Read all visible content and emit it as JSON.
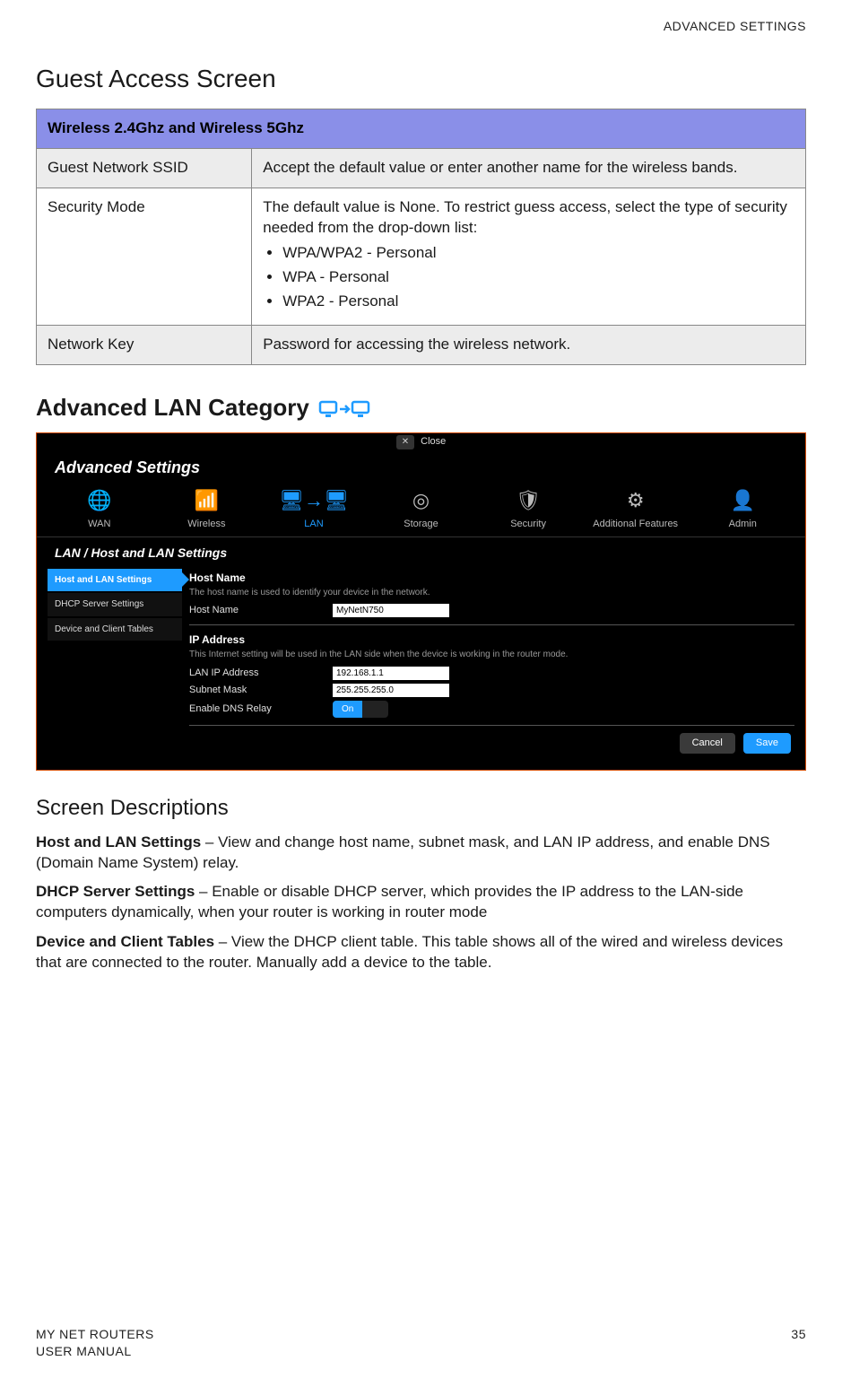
{
  "header": {
    "section": "ADVANCED SETTINGS"
  },
  "guest": {
    "heading": "Guest Access Screen",
    "table_header": "Wireless 2.4Ghz and Wireless 5Ghz",
    "rows": [
      {
        "label": "Guest Network SSID",
        "desc": "Accept the default value or enter another name for the wireless bands."
      },
      {
        "label": "Security Mode",
        "desc": "The default value is None. To restrict guess access, select the type of security needed from the drop-down list:",
        "bullets": [
          "WPA/WPA2 - Personal",
          "WPA - Personal",
          "WPA2 - Personal"
        ]
      },
      {
        "label": "Network Key",
        "desc": "Password for accessing the wireless network."
      }
    ]
  },
  "lan": {
    "heading": "Advanced LAN Category"
  },
  "screenshot": {
    "close_label": "Close",
    "title": "Advanced Settings",
    "tabs": [
      "WAN",
      "Wireless",
      "LAN",
      "Storage",
      "Security",
      "Additional Features",
      "Admin"
    ],
    "subhead": "LAN / Host and LAN Settings",
    "side": [
      "Host and LAN Settings",
      "DHCP Server Settings",
      "Device and Client Tables"
    ],
    "hostname_sec": "Host Name",
    "hostname_desc": "The host name is used to identify your device in the network.",
    "hostname_label": "Host Name",
    "hostname_value": "MyNetN750",
    "ip_sec": "IP Address",
    "ip_desc": "This Internet setting will be used in the LAN side when the device is working in the router mode.",
    "lanip_label": "LAN IP Address",
    "lanip_value": "192.168.1.1",
    "subnet_label": "Subnet Mask",
    "subnet_value": "255.255.255.0",
    "dns_label": "Enable DNS Relay",
    "toggle_on": "On",
    "cancel": "Cancel",
    "save": "Save"
  },
  "descriptions": {
    "heading": "Screen Descriptions",
    "items": [
      {
        "title": "Host and LAN Settings",
        "body": " – View and change host name, subnet mask, and LAN IP address, and enable DNS (Domain Name System) relay."
      },
      {
        "title": "DHCP Server Settings",
        "body": " – Enable or disable DHCP server, which provides the IP address to the LAN-side computers dynamically, when your router is working in router mode"
      },
      {
        "title": "Device and Client Tables",
        "body": " – View the DHCP client table. This table shows all of the wired and wireless devices that are connected to the router. Manually add a device to the table."
      }
    ]
  },
  "footer": {
    "left1": "MY NET ROUTERS",
    "left2": "USER MANUAL",
    "page": "35"
  }
}
